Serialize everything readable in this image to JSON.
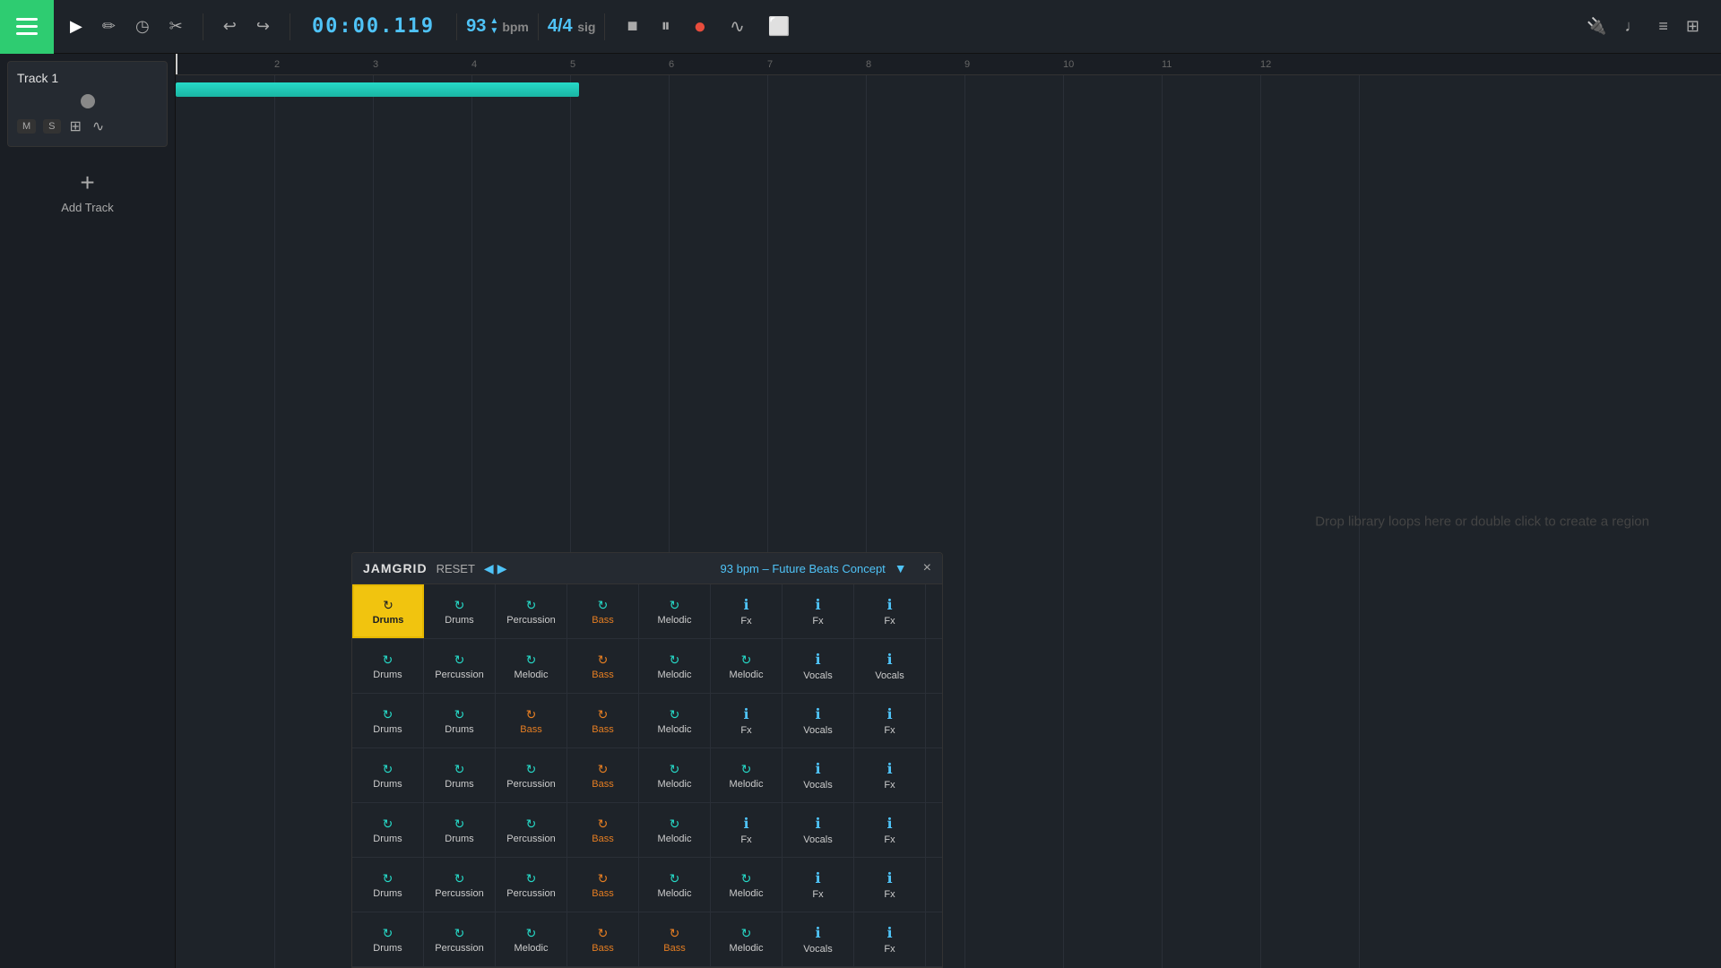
{
  "toolbar": {
    "time": "00:00.119",
    "bpm": "93",
    "bpm_label": "bpm",
    "sig_num": "4/4",
    "sig_label": "sig",
    "menu_aria": "Menu"
  },
  "track": {
    "name": "Track 1"
  },
  "add_track_label": "Add Track",
  "ruler": {
    "marks": [
      "2",
      "3",
      "4",
      "5",
      "6",
      "7",
      "8",
      "9",
      "10",
      "11",
      "12"
    ]
  },
  "drop_hint": "Drop library loops here or double click to create a region",
  "jamgrid": {
    "title": "JAMGRID",
    "reset": "RESET",
    "bpm_label": "93 bpm – Future Beats Concept",
    "close": "×",
    "rows": [
      [
        {
          "label": "Drums",
          "icon": "↻",
          "type": "active"
        },
        {
          "label": "Drums",
          "icon": "↻",
          "type": "teal"
        },
        {
          "label": "Percussion",
          "icon": "↻",
          "type": "teal"
        },
        {
          "label": "Bass",
          "icon": "↻",
          "type": "teal"
        },
        {
          "label": "Melodic",
          "icon": "↻",
          "type": "teal"
        },
        {
          "label": "Fx",
          "icon": "ℹ",
          "type": "info"
        },
        {
          "label": "Fx",
          "icon": "ℹ",
          "type": "info"
        },
        {
          "label": "Fx",
          "icon": "ℹ",
          "type": "info"
        }
      ],
      [
        {
          "label": "Drums",
          "icon": "↻",
          "type": "teal"
        },
        {
          "label": "Percussion",
          "icon": "↻",
          "type": "teal"
        },
        {
          "label": "Melodic",
          "icon": "↻",
          "type": "teal"
        },
        {
          "label": "Bass",
          "icon": "↻",
          "type": "orange"
        },
        {
          "label": "Melodic",
          "icon": "↻",
          "type": "teal"
        },
        {
          "label": "Melodic",
          "icon": "↻",
          "type": "teal"
        },
        {
          "label": "Vocals",
          "icon": "ℹ",
          "type": "info"
        },
        {
          "label": "Vocals",
          "icon": "ℹ",
          "type": "info"
        }
      ],
      [
        {
          "label": "Drums",
          "icon": "↻",
          "type": "teal"
        },
        {
          "label": "Drums",
          "icon": "↻",
          "type": "teal"
        },
        {
          "label": "Bass",
          "icon": "↻",
          "type": "orange"
        },
        {
          "label": "Bass",
          "icon": "↻",
          "type": "orange"
        },
        {
          "label": "Melodic",
          "icon": "↻",
          "type": "teal"
        },
        {
          "label": "Fx",
          "icon": "ℹ",
          "type": "info"
        },
        {
          "label": "Vocals",
          "icon": "ℹ",
          "type": "info"
        },
        {
          "label": "Fx",
          "icon": "ℹ",
          "type": "info"
        }
      ],
      [
        {
          "label": "Drums",
          "icon": "↻",
          "type": "teal"
        },
        {
          "label": "Drums",
          "icon": "↻",
          "type": "teal"
        },
        {
          "label": "Percussion",
          "icon": "↻",
          "type": "teal"
        },
        {
          "label": "Bass",
          "icon": "↻",
          "type": "orange"
        },
        {
          "label": "Melodic",
          "icon": "↻",
          "type": "teal"
        },
        {
          "label": "Melodic",
          "icon": "↻",
          "type": "teal"
        },
        {
          "label": "Vocals",
          "icon": "ℹ",
          "type": "info"
        },
        {
          "label": "Fx",
          "icon": "ℹ",
          "type": "info"
        }
      ],
      [
        {
          "label": "Drums",
          "icon": "↻",
          "type": "teal"
        },
        {
          "label": "Drums",
          "icon": "↻",
          "type": "teal"
        },
        {
          "label": "Percussion",
          "icon": "↻",
          "type": "teal"
        },
        {
          "label": "Bass",
          "icon": "↻",
          "type": "orange"
        },
        {
          "label": "Melodic",
          "icon": "↻",
          "type": "teal"
        },
        {
          "label": "Fx",
          "icon": "ℹ",
          "type": "info"
        },
        {
          "label": "Vocals",
          "icon": "ℹ",
          "type": "info"
        },
        {
          "label": "Fx",
          "icon": "ℹ",
          "type": "info"
        }
      ],
      [
        {
          "label": "Drums",
          "icon": "↻",
          "type": "teal"
        },
        {
          "label": "Percussion",
          "icon": "↻",
          "type": "teal"
        },
        {
          "label": "Percussion",
          "icon": "↻",
          "type": "teal"
        },
        {
          "label": "Bass",
          "icon": "↻",
          "type": "orange"
        },
        {
          "label": "Melodic",
          "icon": "↻",
          "type": "teal"
        },
        {
          "label": "Melodic",
          "icon": "↻",
          "type": "teal"
        },
        {
          "label": "Fx",
          "icon": "ℹ",
          "type": "info"
        },
        {
          "label": "Fx",
          "icon": "ℹ",
          "type": "info"
        }
      ],
      [
        {
          "label": "Drums",
          "icon": "↻",
          "type": "teal"
        },
        {
          "label": "Percussion",
          "icon": "↻",
          "type": "teal"
        },
        {
          "label": "Melodic",
          "icon": "↻",
          "type": "teal"
        },
        {
          "label": "Bass",
          "icon": "↻",
          "type": "orange"
        },
        {
          "label": "Bass",
          "icon": "↻",
          "type": "orange"
        },
        {
          "label": "Melodic",
          "icon": "↻",
          "type": "teal"
        },
        {
          "label": "Vocals",
          "icon": "ℹ",
          "type": "info"
        },
        {
          "label": "Fx",
          "icon": "ℹ",
          "type": "info"
        }
      ]
    ]
  }
}
